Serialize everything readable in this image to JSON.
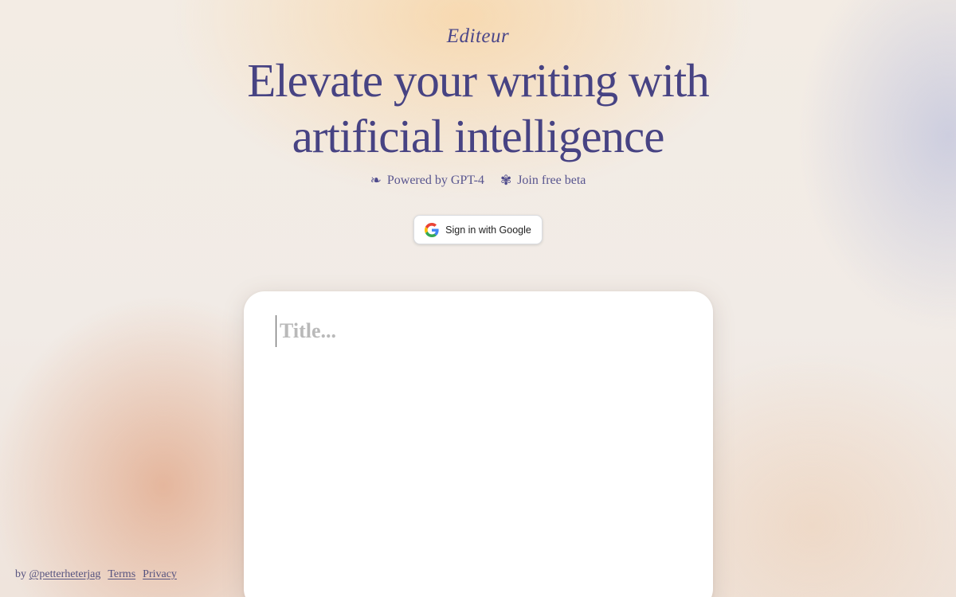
{
  "brand": {
    "name": "Editeur"
  },
  "hero": {
    "headline_line1": "Elevate your writing with",
    "headline_line2": "artificial intelligence"
  },
  "features": [
    {
      "icon": "leaf-ornament-icon",
      "glyph": "❧",
      "label": "Powered by GPT-4"
    },
    {
      "icon": "flower-ornament-icon",
      "glyph": "✾",
      "label": "Join free beta"
    }
  ],
  "auth": {
    "google_button_label": "Sign in with Google",
    "icon": "google-icon"
  },
  "editor": {
    "title_placeholder": "Title...",
    "title_value": ""
  },
  "footer": {
    "by_prefix": "by",
    "author_link": "@petterheterjag",
    "terms_link": "Terms",
    "privacy_link": "Privacy"
  },
  "colors": {
    "accent": "#4a4689",
    "card": "#ffffff",
    "placeholder": "#b9b9b9"
  }
}
